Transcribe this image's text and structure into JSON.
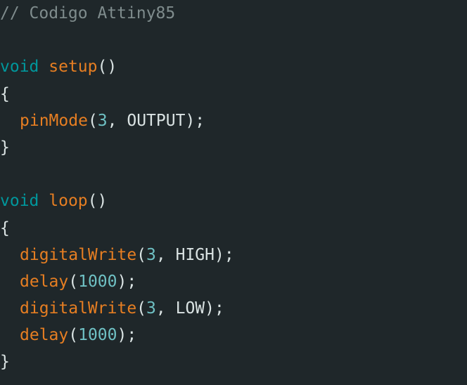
{
  "editor": {
    "colors": {
      "background": "#1f272a",
      "comment": "#7f8c8d",
      "keyword": "#00979c",
      "function": "#e67e22",
      "number": "#6fc1c4",
      "text": "#dae3e3"
    },
    "lines": [
      {
        "tokens": [
          {
            "type": "comment",
            "text": "// Codigo Attiny85"
          }
        ]
      },
      {
        "tokens": []
      },
      {
        "tokens": [
          {
            "type": "keyword",
            "text": "void"
          },
          {
            "type": "punct",
            "text": " "
          },
          {
            "type": "func",
            "text": "setup"
          },
          {
            "type": "punct",
            "text": "()"
          }
        ]
      },
      {
        "tokens": [
          {
            "type": "punct",
            "text": "{"
          }
        ]
      },
      {
        "indent": true,
        "tokens": [
          {
            "type": "func",
            "text": "pinMode"
          },
          {
            "type": "punct",
            "text": "("
          },
          {
            "type": "number",
            "text": "3"
          },
          {
            "type": "punct",
            "text": ", "
          },
          {
            "type": "const",
            "text": "OUTPUT"
          },
          {
            "type": "punct",
            "text": ");"
          }
        ]
      },
      {
        "tokens": [
          {
            "type": "punct",
            "text": "}"
          }
        ]
      },
      {
        "tokens": []
      },
      {
        "tokens": [
          {
            "type": "keyword",
            "text": "void"
          },
          {
            "type": "punct",
            "text": " "
          },
          {
            "type": "func",
            "text": "loop"
          },
          {
            "type": "punct",
            "text": "()"
          }
        ]
      },
      {
        "tokens": [
          {
            "type": "punct",
            "text": "{"
          }
        ]
      },
      {
        "indent": true,
        "tokens": [
          {
            "type": "func",
            "text": "digitalWrite"
          },
          {
            "type": "punct",
            "text": "("
          },
          {
            "type": "number",
            "text": "3"
          },
          {
            "type": "punct",
            "text": ", "
          },
          {
            "type": "const",
            "text": "HIGH"
          },
          {
            "type": "punct",
            "text": ");"
          }
        ]
      },
      {
        "indent": true,
        "tokens": [
          {
            "type": "func",
            "text": "delay"
          },
          {
            "type": "punct",
            "text": "("
          },
          {
            "type": "number",
            "text": "1000"
          },
          {
            "type": "punct",
            "text": ");"
          }
        ]
      },
      {
        "indent": true,
        "tokens": [
          {
            "type": "func",
            "text": "digitalWrite"
          },
          {
            "type": "punct",
            "text": "("
          },
          {
            "type": "number",
            "text": "3"
          },
          {
            "type": "punct",
            "text": ", "
          },
          {
            "type": "const",
            "text": "LOW"
          },
          {
            "type": "punct",
            "text": ");"
          }
        ]
      },
      {
        "indent": true,
        "tokens": [
          {
            "type": "func",
            "text": "delay"
          },
          {
            "type": "punct",
            "text": "("
          },
          {
            "type": "number",
            "text": "1000"
          },
          {
            "type": "punct",
            "text": ");"
          }
        ]
      },
      {
        "tokens": [
          {
            "type": "punct",
            "text": "}"
          }
        ]
      }
    ]
  }
}
